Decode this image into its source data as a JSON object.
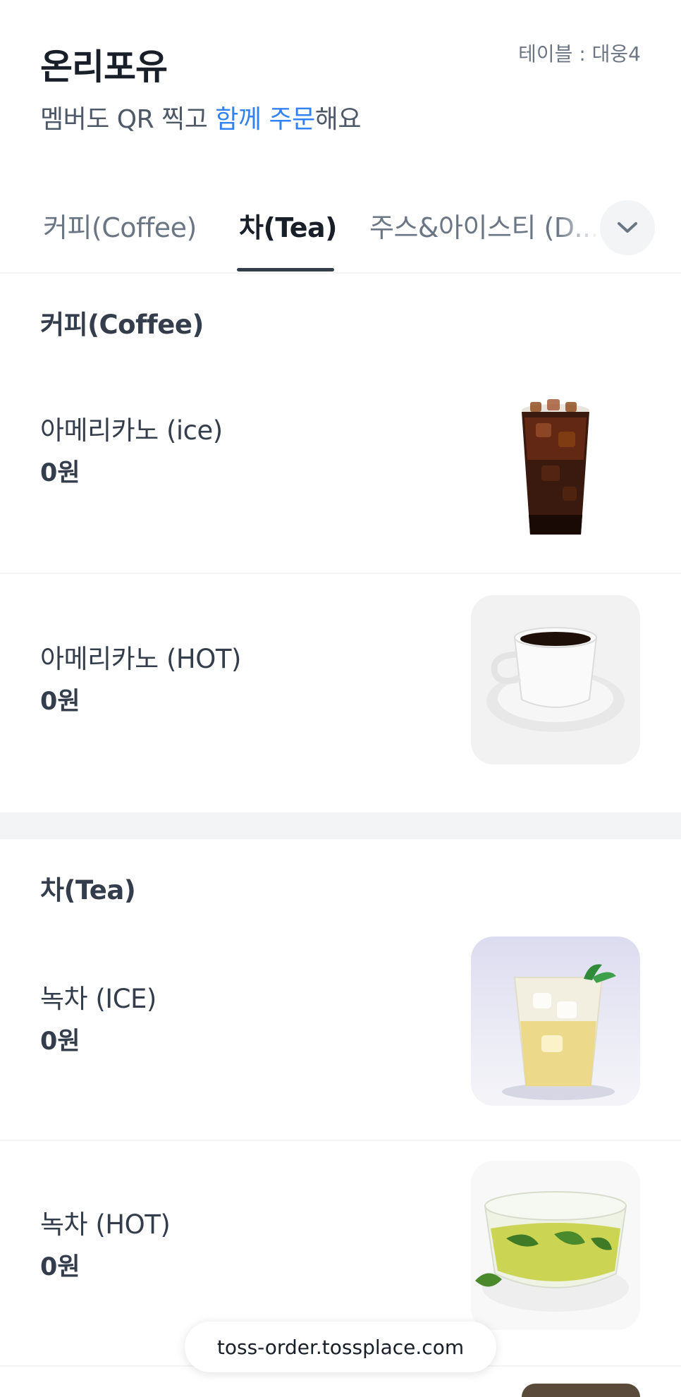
{
  "header": {
    "store_name": "온리포유",
    "table_label": "테이블 : 대웅4",
    "subtitle_prefix": "멤버도 QR 찍고 ",
    "subtitle_highlight": "함께 주문",
    "subtitle_suffix": "해요"
  },
  "tabs": [
    {
      "label": "커피(Coffee)",
      "active": false
    },
    {
      "label": "차(Tea)",
      "active": true
    },
    {
      "label": "주스&아이스티 (D...",
      "active": false
    }
  ],
  "sections": [
    {
      "title": "커피(Coffee)",
      "items": [
        {
          "name": "아메리카노 (ice)",
          "price": "0원",
          "image": "iced-americano-cup"
        },
        {
          "name": "아메리카노 (HOT)",
          "price": "0원",
          "image": "hot-coffee-cup"
        }
      ]
    },
    {
      "title": "차(Tea)",
      "items": [
        {
          "name": "녹차 (ICE)",
          "price": "0원",
          "image": "iced-tea-glass"
        },
        {
          "name": "녹차 (HOT)",
          "price": "0원",
          "image": "green-tea-cup"
        }
      ]
    }
  ],
  "footer": {
    "url": "toss-order.tossplace.com"
  },
  "colors": {
    "accent": "#3182f6",
    "text": "#191f28",
    "muted": "#6b7684",
    "divider": "#f2f4f6"
  }
}
